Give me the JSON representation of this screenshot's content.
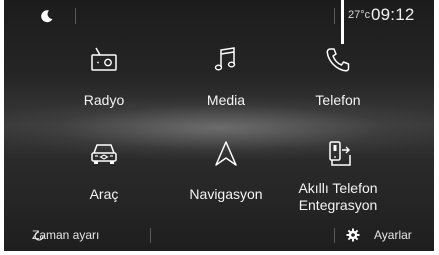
{
  "status": {
    "temperature": "27°c",
    "clock": "09:12"
  },
  "home": {
    "tiles": [
      {
        "label": "Radyo",
        "icon": "radio-icon"
      },
      {
        "label": "Media",
        "icon": "music-note-icon"
      },
      {
        "label": "Telefon",
        "icon": "phone-icon"
      },
      {
        "label": "Araç",
        "icon": "car-icon"
      },
      {
        "label": "Navigasyon",
        "icon": "navigation-arrow-icon"
      },
      {
        "label": "Akıllı Telefon Entegrasyon",
        "icon": "smartphone-mirror-icon"
      }
    ]
  },
  "bottom": {
    "left_label": "Zaman ayarı",
    "right_label": "Ayarlar"
  },
  "colors": {
    "background_top": "#1c1c1c",
    "background_mid": "#3a3a3a",
    "text": "#ffffff"
  }
}
